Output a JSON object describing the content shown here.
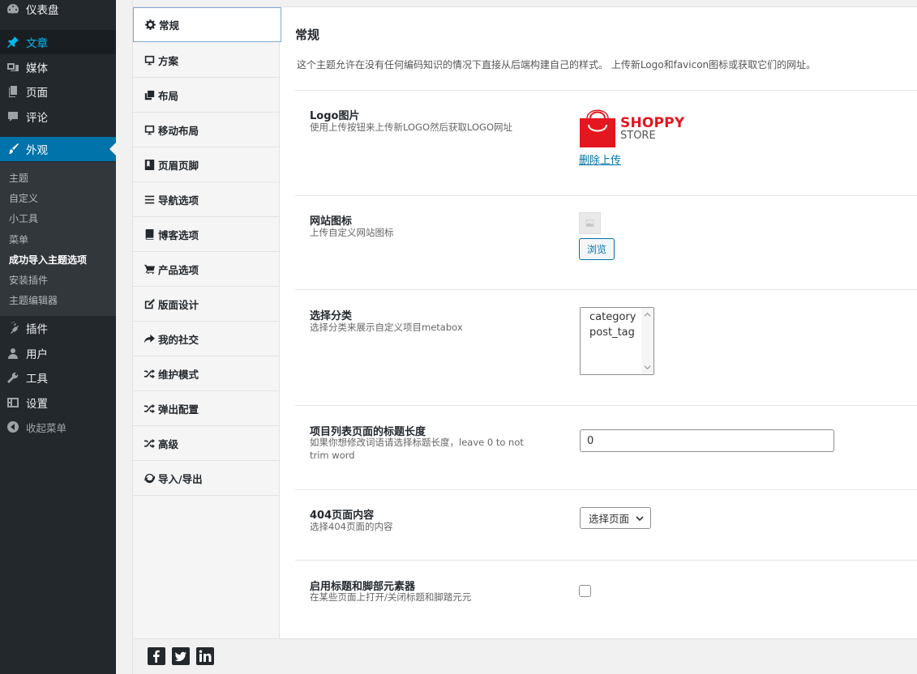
{
  "sidebar": {
    "items": [
      {
        "label": "仪表盘",
        "icon": "dashboard-icon"
      },
      {
        "label": "文章",
        "icon": "pin-icon"
      },
      {
        "label": "媒体",
        "icon": "media-icon"
      },
      {
        "label": "页面",
        "icon": "page-icon"
      },
      {
        "label": "评论",
        "icon": "comment-icon"
      },
      {
        "label": "外观",
        "icon": "brush-icon"
      },
      {
        "label": "插件",
        "icon": "plugin-icon"
      },
      {
        "label": "用户",
        "icon": "user-icon"
      },
      {
        "label": "工具",
        "icon": "wrench-icon"
      },
      {
        "label": "设置",
        "icon": "settings-icon"
      },
      {
        "label": "收起菜单",
        "icon": "collapse-icon"
      }
    ],
    "submenu": [
      "主题",
      "自定义",
      "小工具",
      "菜单",
      "成功导入主题选项",
      "安装插件",
      "主题编辑器"
    ],
    "accent": "#0073aa"
  },
  "tabs": [
    {
      "label": "常规",
      "icon": "gear-icon"
    },
    {
      "label": "方案",
      "icon": "desktop-icon"
    },
    {
      "label": "布局",
      "icon": "copy-icon"
    },
    {
      "label": "移动布局",
      "icon": "desktop-icon"
    },
    {
      "label": "页眉页脚",
      "icon": "bookmark-icon"
    },
    {
      "label": "导航选项",
      "icon": "bars-icon"
    },
    {
      "label": "博客选项",
      "icon": "book-icon"
    },
    {
      "label": "产品选项",
      "icon": "cart-icon"
    },
    {
      "label": "版面设计",
      "icon": "edit-icon"
    },
    {
      "label": "我的社交",
      "icon": "share-icon"
    },
    {
      "label": "维护模式",
      "icon": "shuffle-icon"
    },
    {
      "label": "弹出配置",
      "icon": "shuffle-icon"
    },
    {
      "label": "高级",
      "icon": "shuffle-icon"
    },
    {
      "label": "导入/导出",
      "icon": "refresh-icon"
    }
  ],
  "main": {
    "title": "常规",
    "description": "这个主题允许在没有任何编码知识的情况下直接从后端构建自己的样式。 上传新Logo和favicon图标或获取它们的网址。",
    "logo": {
      "label": "Logo图片",
      "help": "使用上传按钮来上传新LOGO然后获取LOGO网址",
      "brand_line1": "SHOPPY",
      "brand_line2": "STORE",
      "remove_label": "删除上传",
      "brand_color": "#e4161f"
    },
    "favicon": {
      "label": "网站图标",
      "help": "上传自定义网站图标",
      "browse_label": "浏览"
    },
    "taxonomy": {
      "label": "选择分类",
      "help": "选择分类来展示自定义项目metabox",
      "options": [
        "category",
        "post_tag"
      ]
    },
    "title_length": {
      "label": "项目列表页面的标题长度",
      "help": "如果你想修改词语请选择标题长度，leave 0 to not trim word",
      "value": "0"
    },
    "page404": {
      "label": "404页面内容",
      "help": "选择404页面的内容",
      "selected": "选择页面"
    },
    "header_footer": {
      "label": "启用标题和脚部元素器",
      "help": "在某些页面上打开/关闭标题和脚踏元元",
      "checked": false
    }
  },
  "footer": {
    "social": [
      "facebook-icon",
      "twitter-icon",
      "linkedin-icon"
    ]
  }
}
